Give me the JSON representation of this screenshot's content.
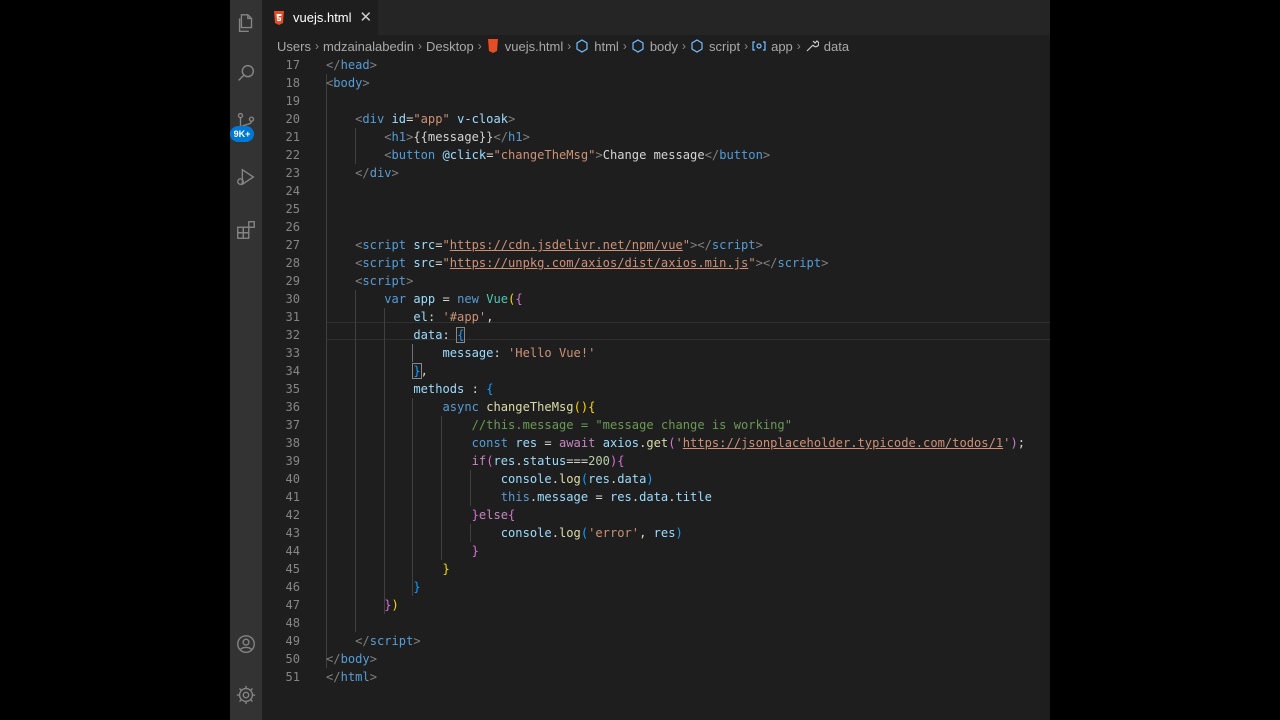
{
  "colors": {
    "editor_bg": "#1e1e1e",
    "activity_bar_bg": "#333333",
    "tab_bar_bg": "#252526",
    "badge": "#0078d4",
    "html_icon": "#e44d26"
  },
  "activity_bar": {
    "items": [
      {
        "name": "explorer",
        "icon": "files-icon"
      },
      {
        "name": "search",
        "icon": "search-icon"
      },
      {
        "name": "source-control",
        "icon": "source-control-icon"
      },
      {
        "name": "run-debug",
        "icon": "run-debug-icon"
      },
      {
        "name": "extensions",
        "icon": "extensions-icon"
      }
    ],
    "scm_badge": "9K+",
    "bottom": [
      {
        "name": "accounts",
        "icon": "account-icon"
      },
      {
        "name": "manage",
        "icon": "gear-icon"
      }
    ]
  },
  "tab": {
    "label": "vuejs.html",
    "icon": "html5-icon",
    "close_icon": "close-icon",
    "close_glyph": "✕"
  },
  "breadcrumb": [
    "Users",
    "mdzainalabedin",
    "Desktop",
    "vuejs.html",
    "html",
    "body",
    "script",
    "app",
    "data"
  ],
  "editor": {
    "lines": [
      {
        "n": "17",
        "tokens": [
          [
            "</",
            "punc"
          ],
          [
            "head",
            "tag"
          ],
          [
            ">",
            "punc"
          ]
        ]
      },
      {
        "n": "18",
        "tokens": [
          [
            "<",
            "punc"
          ],
          [
            "body",
            "tag"
          ],
          [
            ">",
            "punc"
          ]
        ]
      },
      {
        "n": "19",
        "tokens": []
      },
      {
        "n": "20",
        "tokens": [
          [
            "    ",
            "text"
          ],
          [
            "<",
            "punc"
          ],
          [
            "div",
            "tag"
          ],
          [
            " ",
            "text"
          ],
          [
            "id",
            "attr"
          ],
          [
            "=",
            "text"
          ],
          [
            "\"app\"",
            "str"
          ],
          [
            " ",
            "text"
          ],
          [
            "v-cloak",
            "attr"
          ],
          [
            ">",
            "punc"
          ]
        ]
      },
      {
        "n": "21",
        "tokens": [
          [
            "        ",
            "text"
          ],
          [
            "<",
            "punc"
          ],
          [
            "h1",
            "tag"
          ],
          [
            ">",
            "punc"
          ],
          [
            "{{message}}",
            "text"
          ],
          [
            "</",
            "punc"
          ],
          [
            "h1",
            "tag"
          ],
          [
            ">",
            "punc"
          ]
        ]
      },
      {
        "n": "22",
        "tokens": [
          [
            "        ",
            "text"
          ],
          [
            "<",
            "punc"
          ],
          [
            "button",
            "tag"
          ],
          [
            " ",
            "text"
          ],
          [
            "@click",
            "attr"
          ],
          [
            "=",
            "text"
          ],
          [
            "\"changeTheMsg\"",
            "str"
          ],
          [
            ">",
            "punc"
          ],
          [
            "Change message",
            "text"
          ],
          [
            "</",
            "punc"
          ],
          [
            "button",
            "tag"
          ],
          [
            ">",
            "punc"
          ]
        ]
      },
      {
        "n": "23",
        "tokens": [
          [
            "    ",
            "text"
          ],
          [
            "</",
            "punc"
          ],
          [
            "div",
            "tag"
          ],
          [
            ">",
            "punc"
          ]
        ]
      },
      {
        "n": "24",
        "tokens": []
      },
      {
        "n": "25",
        "tokens": []
      },
      {
        "n": "26",
        "tokens": []
      },
      {
        "n": "27",
        "tokens": [
          [
            "    ",
            "text"
          ],
          [
            "<",
            "punc"
          ],
          [
            "script",
            "tag"
          ],
          [
            " ",
            "text"
          ],
          [
            "src",
            "attr"
          ],
          [
            "=",
            "text"
          ],
          [
            "\"",
            "str"
          ],
          [
            "https://cdn.jsdelivr.net/npm/vue",
            "str ul"
          ],
          [
            "\"",
            "str"
          ],
          [
            "></",
            "punc"
          ],
          [
            "script",
            "tag"
          ],
          [
            ">",
            "punc"
          ]
        ]
      },
      {
        "n": "28",
        "tokens": [
          [
            "    ",
            "text"
          ],
          [
            "<",
            "punc"
          ],
          [
            "script",
            "tag"
          ],
          [
            " ",
            "text"
          ],
          [
            "src",
            "attr"
          ],
          [
            "=",
            "text"
          ],
          [
            "\"",
            "str"
          ],
          [
            "https://unpkg.com/axios/dist/axios.min.js",
            "str ul"
          ],
          [
            "\"",
            "str"
          ],
          [
            "></",
            "punc"
          ],
          [
            "script",
            "tag"
          ],
          [
            ">",
            "punc"
          ]
        ]
      },
      {
        "n": "29",
        "tokens": [
          [
            "    ",
            "text"
          ],
          [
            "<",
            "punc"
          ],
          [
            "script",
            "tag"
          ],
          [
            ">",
            "punc"
          ]
        ]
      },
      {
        "n": "30",
        "tokens": [
          [
            "        ",
            "text"
          ],
          [
            "var",
            "kw"
          ],
          [
            " ",
            "text"
          ],
          [
            "app",
            "var"
          ],
          [
            " = ",
            "text"
          ],
          [
            "new",
            "kw"
          ],
          [
            " ",
            "text"
          ],
          [
            "Vue",
            "cls"
          ],
          [
            "(",
            "b1"
          ],
          [
            "{",
            "b2"
          ]
        ]
      },
      {
        "n": "31",
        "tokens": [
          [
            "            ",
            "text"
          ],
          [
            "el",
            "var"
          ],
          [
            ": ",
            "text"
          ],
          [
            "'#app'",
            "str"
          ],
          [
            ",",
            "text"
          ]
        ]
      },
      {
        "n": "32",
        "tokens": [
          [
            "            ",
            "text"
          ],
          [
            "data",
            "var"
          ],
          [
            ": ",
            "text"
          ],
          [
            "{",
            "b3 bmatch"
          ]
        ]
      },
      {
        "n": "33",
        "tokens": [
          [
            "                ",
            "text"
          ],
          [
            "message",
            "var"
          ],
          [
            ": ",
            "text"
          ],
          [
            "'Hello Vue!'",
            "str"
          ]
        ]
      },
      {
        "n": "34",
        "tokens": [
          [
            "            ",
            "text"
          ],
          [
            "}",
            "b3 bmatch"
          ],
          [
            ",",
            "text"
          ]
        ]
      },
      {
        "n": "35",
        "tokens": [
          [
            "            ",
            "text"
          ],
          [
            "methods",
            "var"
          ],
          [
            " : ",
            "text"
          ],
          [
            "{",
            "b3"
          ]
        ]
      },
      {
        "n": "36",
        "tokens": [
          [
            "                ",
            "text"
          ],
          [
            "async",
            "kw"
          ],
          [
            " ",
            "text"
          ],
          [
            "changeTheMsg",
            "fn"
          ],
          [
            "()",
            "b1"
          ],
          [
            "{",
            "b1"
          ]
        ]
      },
      {
        "n": "37",
        "tokens": [
          [
            "                    ",
            "text"
          ],
          [
            "//this.message = \"message change is working\"",
            "com"
          ]
        ]
      },
      {
        "n": "38",
        "tokens": [
          [
            "                    ",
            "text"
          ],
          [
            "const",
            "kw"
          ],
          [
            " ",
            "text"
          ],
          [
            "res",
            "var"
          ],
          [
            " = ",
            "text"
          ],
          [
            "await",
            "ctrl"
          ],
          [
            " ",
            "text"
          ],
          [
            "axios",
            "var"
          ],
          [
            ".",
            "text"
          ],
          [
            "get",
            "fn"
          ],
          [
            "(",
            "b2"
          ],
          [
            "'",
            "str"
          ],
          [
            "https://jsonplaceholder.typicode.com/todos/1",
            "str ul"
          ],
          [
            "'",
            "str"
          ],
          [
            ")",
            "b2"
          ],
          [
            ";",
            "text"
          ]
        ]
      },
      {
        "n": "39",
        "tokens": [
          [
            "                    ",
            "text"
          ],
          [
            "if",
            "ctrl"
          ],
          [
            "(",
            "b2"
          ],
          [
            "res",
            "var"
          ],
          [
            ".",
            "text"
          ],
          [
            "status",
            "var"
          ],
          [
            "===",
            "text"
          ],
          [
            "200",
            "num"
          ],
          [
            ")",
            "b2"
          ],
          [
            "{",
            "b2"
          ]
        ]
      },
      {
        "n": "40",
        "tokens": [
          [
            "                        ",
            "text"
          ],
          [
            "console",
            "var"
          ],
          [
            ".",
            "text"
          ],
          [
            "log",
            "fn"
          ],
          [
            "(",
            "b3"
          ],
          [
            "res",
            "var"
          ],
          [
            ".",
            "text"
          ],
          [
            "data",
            "var"
          ],
          [
            ")",
            "b3"
          ]
        ]
      },
      {
        "n": "41",
        "tokens": [
          [
            "                        ",
            "text"
          ],
          [
            "this",
            "kw"
          ],
          [
            ".",
            "text"
          ],
          [
            "message",
            "var"
          ],
          [
            " = ",
            "text"
          ],
          [
            "res",
            "var"
          ],
          [
            ".",
            "text"
          ],
          [
            "data",
            "var"
          ],
          [
            ".",
            "text"
          ],
          [
            "title",
            "var"
          ]
        ]
      },
      {
        "n": "42",
        "tokens": [
          [
            "                    ",
            "text"
          ],
          [
            "}",
            "b2"
          ],
          [
            "else",
            "ctrl"
          ],
          [
            "{",
            "b2"
          ]
        ]
      },
      {
        "n": "43",
        "tokens": [
          [
            "                        ",
            "text"
          ],
          [
            "console",
            "var"
          ],
          [
            ".",
            "text"
          ],
          [
            "log",
            "fn"
          ],
          [
            "(",
            "b3"
          ],
          [
            "'error'",
            "str"
          ],
          [
            ", ",
            "text"
          ],
          [
            "res",
            "var"
          ],
          [
            ")",
            "b3"
          ]
        ]
      },
      {
        "n": "44",
        "tokens": [
          [
            "                    ",
            "text"
          ],
          [
            "}",
            "b2"
          ]
        ]
      },
      {
        "n": "45",
        "tokens": [
          [
            "                ",
            "text"
          ],
          [
            "}",
            "b1"
          ]
        ]
      },
      {
        "n": "46",
        "tokens": [
          [
            "            ",
            "text"
          ],
          [
            "}",
            "b3"
          ]
        ]
      },
      {
        "n": "47",
        "tokens": [
          [
            "        ",
            "text"
          ],
          [
            "}",
            "b2"
          ],
          [
            ")",
            "b1"
          ]
        ]
      },
      {
        "n": "48",
        "tokens": []
      },
      {
        "n": "49",
        "tokens": [
          [
            "    ",
            "text"
          ],
          [
            "</",
            "punc"
          ],
          [
            "script",
            "tag"
          ],
          [
            ">",
            "punc"
          ]
        ]
      },
      {
        "n": "50",
        "tokens": [
          [
            "</",
            "punc"
          ],
          [
            "body",
            "tag"
          ],
          [
            ">",
            "punc"
          ]
        ]
      },
      {
        "n": "51",
        "tokens": [
          [
            "</",
            "punc"
          ],
          [
            "html",
            "tag"
          ],
          [
            ">",
            "punc"
          ]
        ]
      }
    ]
  }
}
